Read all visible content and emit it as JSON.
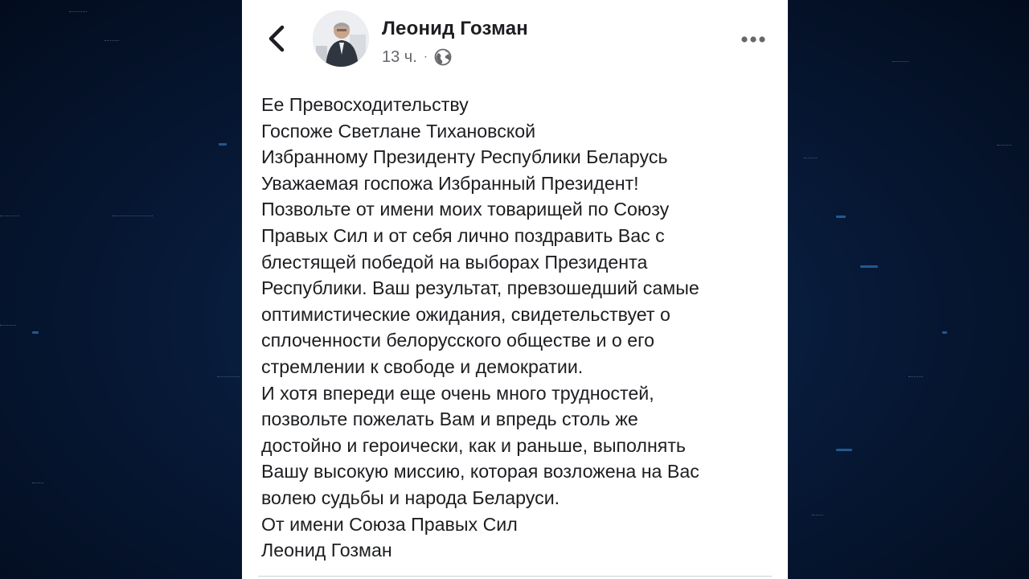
{
  "post": {
    "author": "Леонид Гозман",
    "time": "13 ч.",
    "separator": "·",
    "icons": {
      "back": "chevron-left-icon",
      "audience": "globe-icon",
      "more": "more-horizontal-icon"
    },
    "lines": [
      "Ее Превосходительству",
      "Госпоже Светлане Тихановской",
      "Избранному Президенту Республики Беларусь",
      "Уважаемая госпожа Избранный Президент!",
      "Позвольте от имени моих товарищей по Союзу",
      "Правых Сил и от себя лично поздравить Вас с",
      "блестящей победой на выборах Президента",
      "Республики. Ваш результат, превзошедший самые",
      "оптимистические ожидания, свидетельствует о",
      "сплоченности белорусского обществе и о его",
      "стремлении к свободе и демократии.",
      "И хотя впереди еще очень много трудностей,",
      "позвольте пожелать Вам и впредь столь же",
      "достойно и героически, как и раньше, выполнять",
      "Вашу высокую миссию, которая возложена на Вас",
      "волею судьбы и народа Беларуси.",
      "От имени Союза Правых Сил",
      "Леонид Гозман"
    ]
  },
  "colors": {
    "background": "#071a38",
    "card": "#ffffff",
    "text": "#1c1e21",
    "meta": "#65676b"
  }
}
